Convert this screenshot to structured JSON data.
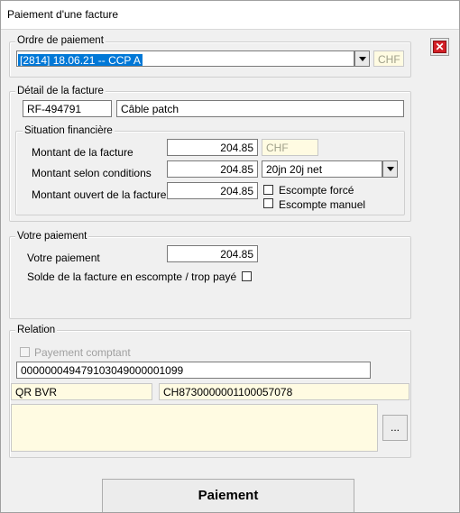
{
  "window": {
    "title": "Paiement d'une facture"
  },
  "ordre": {
    "legend": "Ordre de paiement",
    "selected": "[2814] 18.06.21 -- CCP A",
    "currency": "CHF"
  },
  "detail": {
    "legend": "Détail de la facture",
    "ref": "RF-494791",
    "description": "Câble patch",
    "situation": {
      "legend": "Situation financière",
      "montant_label": "Montant de la facture",
      "montant_value": "204.85",
      "montant_currency": "CHF",
      "conditions_label": "Montant selon conditions",
      "conditions_value": "204.85",
      "conditions_select": "20jn 20j net",
      "ouvert_label": "Montant ouvert de la facture",
      "ouvert_value": "204.85",
      "escompte_force_label": "Escompte forcé",
      "escompte_manuel_label": "Escompte manuel"
    }
  },
  "paiement": {
    "legend": "Votre paiement",
    "label": "Votre paiement",
    "value": "204.85",
    "solde_label": "Solde de la facture en escompte / trop payé"
  },
  "relation": {
    "legend": "Relation",
    "comptant_label": "Payement comptant",
    "reference": "000000049479103049000001099",
    "type": "QR BVR",
    "iban": "CH8730000001100057078",
    "notes": "",
    "browse_label": "..."
  },
  "actions": {
    "payment_button": "Paiement"
  },
  "icons": {
    "close": "close-icon",
    "dropdown": "chevron-down-icon"
  },
  "colors": {
    "readonly_bg": "#fffbe2",
    "selection": "#0078d7",
    "close_red": "#d21f26"
  }
}
